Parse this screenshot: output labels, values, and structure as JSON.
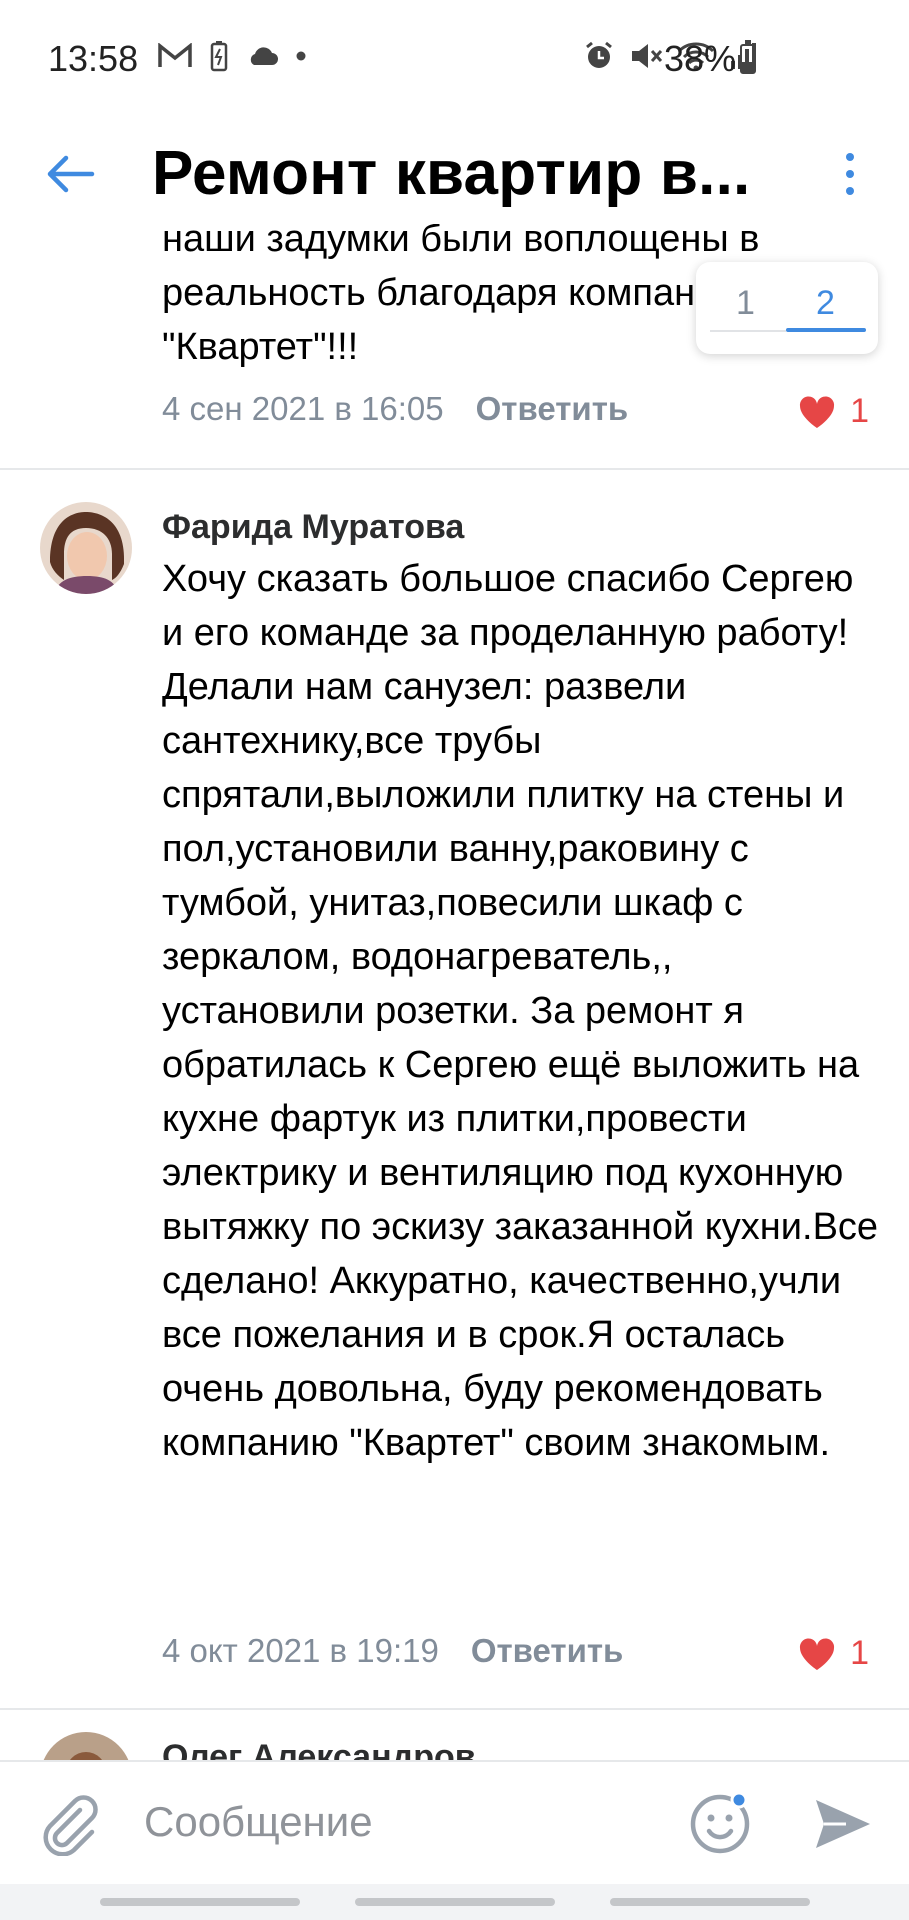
{
  "status_bar": {
    "time": "13:58",
    "battery_percent": "38%",
    "left_icons": [
      "gmail-icon",
      "battery-saver-icon",
      "cloud-icon",
      "dot-icon"
    ],
    "right_icons": [
      "alarm-icon",
      "mute-icon",
      "wifi-icon",
      "signal-icon",
      "battery-icon"
    ],
    "battery_level": 0.38
  },
  "header": {
    "title": "Ремонт квартир в...",
    "accent": "#3f8ae0"
  },
  "pager": {
    "pages": [
      "1",
      "2"
    ],
    "active": "2"
  },
  "comments": [
    {
      "text": "наши задумки были воплощены в реальность благодаря компании \"Квартет\"!!!",
      "date": "4 сен 2021 в 16:05",
      "reply_label": "Ответить",
      "likes": "1"
    },
    {
      "author": "Фарида Муратова",
      "text": "Хочу сказать большое спасибо Сергею и его команде за проделанную работу! Делали нам санузел: развели сантехнику,все трубы спрятали,выложили плитку на стены и пол,установили ванну,раковину с тумбой, унитаз,повесили шкаф с зеркалом, водонагреватель,, установили розетки. За ремонт я обратилась к Сергею ещё выложить на кухне фартук из плитки,провести электрику и вентиляцию под кухонную вытяжку по эскизу заказанной кухни.Все сделано! Аккуратно, качественно,учли все пожелания и в срок.Я осталась очень довольна, буду рекомендовать компанию \"Квартет\" своим знакомым.",
      "date": "4 окт 2021 в 19:19",
      "reply_label": "Ответить",
      "likes": "1"
    },
    {
      "author": "Олег Александров"
    }
  ],
  "composer": {
    "placeholder": "Сообщение"
  },
  "colors": {
    "like": "#e64646",
    "meta": "#818c99",
    "accent": "#3f8ae0"
  }
}
